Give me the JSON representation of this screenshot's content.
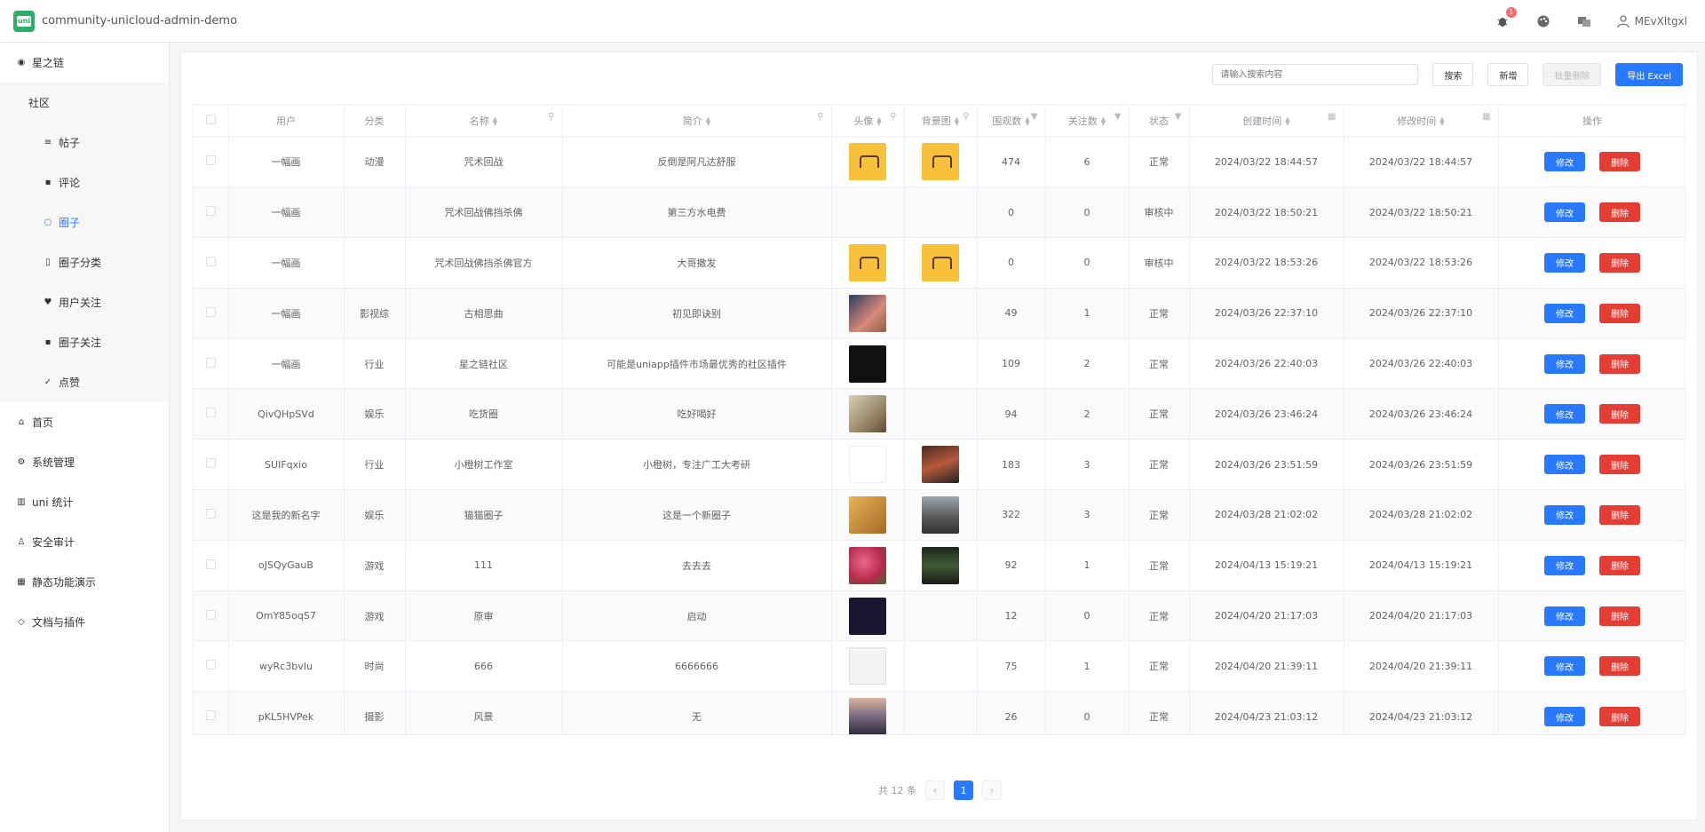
{
  "app": {
    "title": "community-unicloud-admin-demo",
    "user": "MEvXltgxl",
    "notification_count": "1"
  },
  "sidebar": {
    "items": [
      {
        "label": "星之链",
        "icon": "target-icon",
        "level": 0
      },
      {
        "label": "社区",
        "icon": "",
        "level": 1
      },
      {
        "label": "帖子",
        "icon": "list-icon",
        "level": 2
      },
      {
        "label": "评论",
        "icon": "comment-icon",
        "level": 2
      },
      {
        "label": "圈子",
        "icon": "circle-icon",
        "level": 2,
        "active": true
      },
      {
        "label": "圈子分类",
        "icon": "map-icon",
        "level": 2
      },
      {
        "label": "用户关注",
        "icon": "heart-icon",
        "level": 2
      },
      {
        "label": "圈子关注",
        "icon": "comment-icon",
        "level": 2
      },
      {
        "label": "点赞",
        "icon": "thumb-icon",
        "level": 2
      },
      {
        "label": "首页",
        "icon": "home-icon",
        "level": 0
      },
      {
        "label": "系统管理",
        "icon": "gear-icon",
        "level": 0
      },
      {
        "label": "uni 统计",
        "icon": "chart-icon",
        "level": 0
      },
      {
        "label": "安全审计",
        "icon": "user-icon",
        "level": 0
      },
      {
        "label": "静态功能演示",
        "icon": "grid-icon",
        "level": 0
      },
      {
        "label": "文档与插件",
        "icon": "doc-icon",
        "level": 0
      }
    ]
  },
  "toolbar": {
    "search_placeholder": "请输入搜索内容",
    "search_label": "搜索",
    "add_label": "新增",
    "batch_delete_label": "批量删除",
    "export_label": "导出 Excel"
  },
  "table": {
    "headers": [
      "用户",
      "分类",
      "名称",
      "简介",
      "头像",
      "背景图",
      "围观数",
      "关注数",
      "状态",
      "创建时间",
      "修改时间",
      "操作"
    ],
    "edit_label": "修改",
    "delete_label": "删除",
    "rows": [
      {
        "user": "一幅画",
        "category": "动漫",
        "name": "咒术回战",
        "intro": "反倒是阿凡达舒服",
        "avatar": "t-yellow",
        "bg": "t-yellow",
        "views": "474",
        "follows": "6",
        "status": "正常",
        "created": "2024/03/22 18:44:57",
        "modified": "2024/03/22 18:44:57"
      },
      {
        "user": "一幅画",
        "category": "",
        "name": "咒术回战佛挡杀佛",
        "intro": "第三方水电费",
        "avatar": "",
        "bg": "",
        "views": "0",
        "follows": "0",
        "status": "审核中",
        "created": "2024/03/22 18:50:21",
        "modified": "2024/03/22 18:50:21"
      },
      {
        "user": "一幅画",
        "category": "",
        "name": "咒术回战佛挡杀佛官方",
        "intro": "大哥撒发",
        "avatar": "t-yellow",
        "bg": "t-yellow",
        "views": "0",
        "follows": "0",
        "status": "审核中",
        "created": "2024/03/22 18:53:26",
        "modified": "2024/03/22 18:53:26"
      },
      {
        "user": "一幅画",
        "category": "影视综",
        "name": "古相思曲",
        "intro": "初见即诀别",
        "avatar": "t-photo1",
        "bg": "",
        "views": "49",
        "follows": "1",
        "status": "正常",
        "created": "2024/03/26 22:37:10",
        "modified": "2024/03/26 22:37:10"
      },
      {
        "user": "一幅画",
        "category": "行业",
        "name": "星之链社区",
        "intro": "可能是uniapp插件市场最优秀的社区插件",
        "avatar": "t-dark",
        "bg": "",
        "views": "109",
        "follows": "2",
        "status": "正常",
        "created": "2024/03/26 22:40:03",
        "modified": "2024/03/26 22:40:03"
      },
      {
        "user": "QivQHpSVd",
        "category": "娱乐",
        "name": "吃货圈",
        "intro": "吃好喝好",
        "avatar": "t-photo2",
        "bg": "",
        "views": "94",
        "follows": "2",
        "status": "正常",
        "created": "2024/03/26 23:46:24",
        "modified": "2024/03/26 23:46:24"
      },
      {
        "user": "SUIFqxio",
        "category": "行业",
        "name": "小橙树工作室",
        "intro": "小橙树，专注广工大考研",
        "avatar": "t-tree",
        "bg": "t-photo3",
        "views": "183",
        "follows": "3",
        "status": "正常",
        "created": "2024/03/26 23:51:59",
        "modified": "2024/03/26 23:51:59"
      },
      {
        "user": "这是我的新名字",
        "category": "娱乐",
        "name": "猫猫圈子",
        "intro": "这是一个新圈子",
        "avatar": "t-photo4",
        "bg": "t-photo5",
        "views": "322",
        "follows": "3",
        "status": "正常",
        "created": "2024/03/28 21:02:02",
        "modified": "2024/03/28 21:02:02"
      },
      {
        "user": "oJSQyGauB",
        "category": "游戏",
        "name": "111",
        "intro": "去去去",
        "avatar": "t-photo6",
        "bg": "t-photo7",
        "views": "92",
        "follows": "1",
        "status": "正常",
        "created": "2024/04/13 15:19:21",
        "modified": "2024/04/13 15:19:21"
      },
      {
        "user": "OmY85oqS7",
        "category": "游戏",
        "name": "原审",
        "intro": "启动",
        "avatar": "t-photo8",
        "bg": "",
        "views": "12",
        "follows": "0",
        "status": "正常",
        "created": "2024/04/20 21:17:03",
        "modified": "2024/04/20 21:17:03"
      },
      {
        "user": "wyRc3bvIu",
        "category": "时尚",
        "name": "666",
        "intro": "6666666",
        "avatar": "t-photo9",
        "bg": "",
        "views": "75",
        "follows": "1",
        "status": "正常",
        "created": "2024/04/20 21:39:11",
        "modified": "2024/04/20 21:39:11"
      },
      {
        "user": "pKL5HVPek",
        "category": "摄影",
        "name": "风景",
        "intro": "无",
        "avatar": "t-photo10",
        "bg": "",
        "views": "26",
        "follows": "0",
        "status": "正常",
        "created": "2024/04/23 21:03:12",
        "modified": "2024/04/23 21:03:12"
      }
    ]
  },
  "pagination": {
    "total_text": "共 12 条",
    "current_page": "1"
  }
}
